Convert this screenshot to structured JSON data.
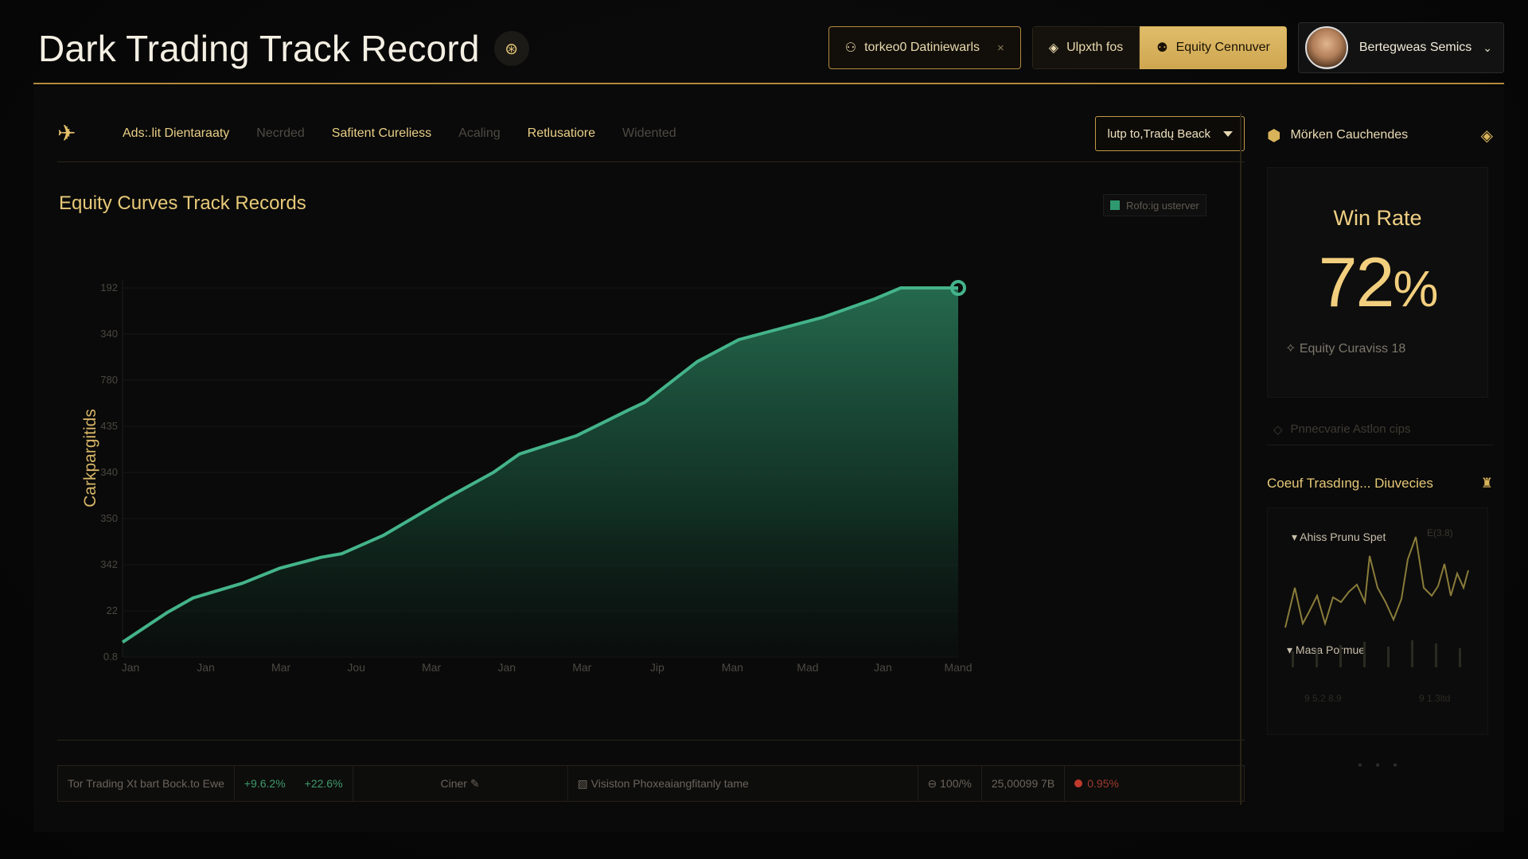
{
  "header": {
    "title": "Dark Trading Track Record",
    "filter_chip": "torkeo0 Datiniewarls",
    "seg_inactive": "Ulpxth fos",
    "seg_active": "Equity Cennuver",
    "user_name": "Bertegweas Semics"
  },
  "toolbar": {
    "brand": "Ads:.lit Dientaraaty",
    "items": [
      "Necrded",
      "Safitent Cureliess",
      "Acaling",
      "Retlusatiore",
      "Widented"
    ],
    "dropdown_label": "lutp to,Tradų Beack"
  },
  "chart_data": {
    "type": "area",
    "title": "Equity Curves Track Records",
    "ylabel": "Carkpargitids",
    "legend": [
      "Rofo:ig usterver"
    ],
    "x_labels": [
      "Jan",
      "Jan",
      "Mar",
      "Jou",
      "Mar",
      "Jan",
      "Mar",
      "Jip",
      "Man",
      "Mad",
      "Jan",
      "Mand"
    ],
    "y_labels": [
      "0.8",
      "22",
      "342",
      "350",
      "340",
      "435",
      "780",
      "340",
      "192"
    ],
    "series": [
      {
        "name": "Rofo:ig usterver",
        "x": [
          0,
          0.085,
          0.135,
          0.23,
          0.3,
          0.3,
          0.38,
          0.42,
          0.5,
          0.62,
          0.71,
          0.76,
          0.87,
          0.97,
          1.0,
          1.1,
          1.18,
          1.34,
          1.44,
          1.49,
          1.6
        ],
        "values": [
          0.04,
          0.12,
          0.16,
          0.2,
          0.24,
          0.24,
          0.27,
          0.28,
          0.33,
          0.43,
          0.5,
          0.55,
          0.6,
          0.67,
          0.69,
          0.8,
          0.86,
          0.92,
          0.97,
          1.0,
          1.0
        ]
      }
    ]
  },
  "footer": {
    "label": "Tor Trading Xt bart Bock.to Ewe",
    "change1": "+9.6.2%",
    "change2": "+22.6%",
    "mid": "Ciner",
    "desc": "Visiston Phoxeaiangfitanly tame",
    "stat1": "100/%",
    "stat2": "25,00099 7B",
    "stat3": "0.95%"
  },
  "side": {
    "head": "Mörken Cauchendes",
    "card_label": "Win Rate",
    "card_value": "72",
    "card_pct": "%",
    "card_sub": "Equity Curaviss 18",
    "muted": "Pnnecvarie Astlon cips",
    "section_title": "Coeuf Trasdıng... Diuvecies",
    "mini_label1": "Ahiss Prunu Spet",
    "mini_label2": "Masa Pormue",
    "mini_corner": "E(3.8)",
    "mini_bottom_left": "9 5.2 8.9",
    "mini_bottom_right": "9 1.3ltd",
    "dots": "• • •"
  }
}
